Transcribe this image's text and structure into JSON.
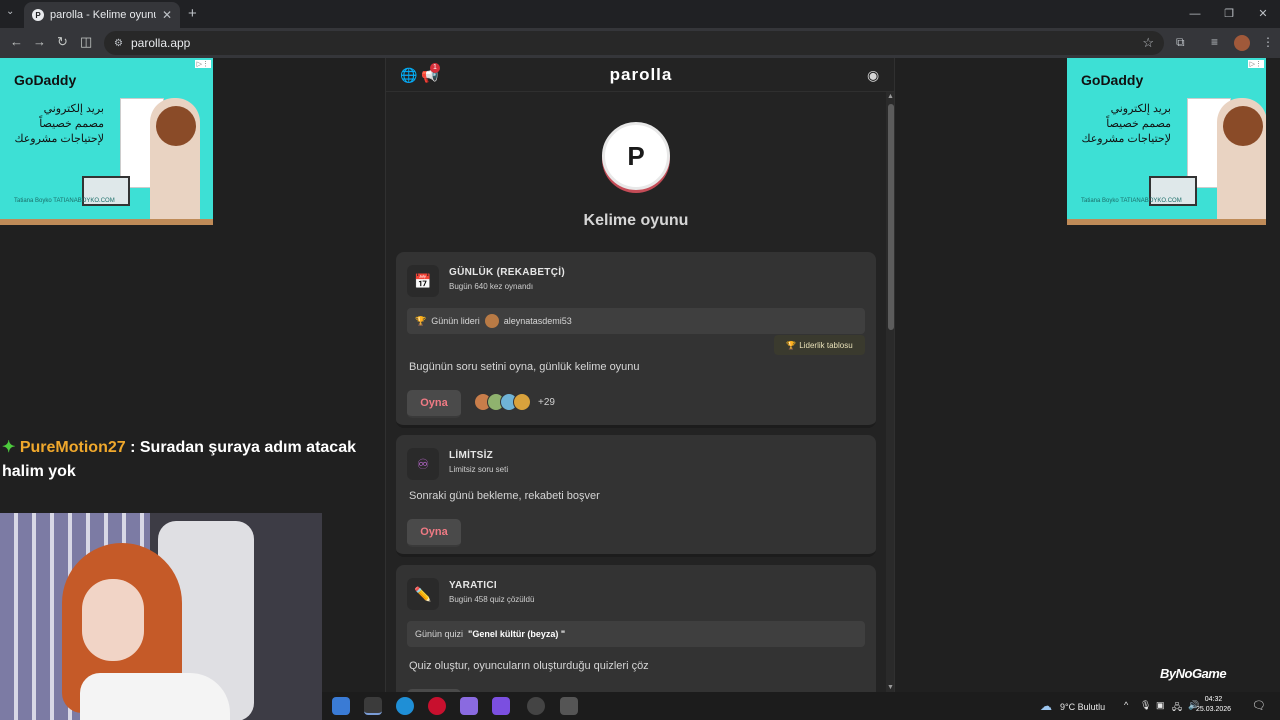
{
  "browser": {
    "tab_title": "parolla - Kelime oyunu. Günlü",
    "url": "parolla.app"
  },
  "ads": {
    "brand": "GoDaddy",
    "text": "بريد إلكتروني مصمم خصيصاً لإحتياجات مشروعك",
    "signature": "Tatiana Boyko TATIANABOYKO.COM"
  },
  "stream": {
    "chat_user": "PureMotion27",
    "chat_message": ": Suradan şuraya adım atacak halim yok",
    "watermark": "ByNoGame"
  },
  "app": {
    "brand": "parolla",
    "notification_count": "1",
    "avatar_letter": "P",
    "page_title": "Kelime oyunu",
    "cards": {
      "daily": {
        "title": "GÜNLÜK (REKABETÇİ)",
        "subtitle": "Bugün 640 kez oynandı",
        "leader_label": "Günün lideri",
        "leader_name": "aleynatasdemi53",
        "leaderboard_button": "Liderlik tablosu",
        "description": "Bugünün soru setini oyna, günlük kelime oyunu",
        "play_label": "Oyna",
        "more_players": "+29"
      },
      "unlimited": {
        "title": "LİMİTSİZ",
        "subtitle": "Limitsiz soru seti",
        "description": "Sonraki günü bekleme, rekabeti boşver",
        "play_label": "Oyna"
      },
      "creative": {
        "title": "YARATICI",
        "subtitle": "Bugün 458 quiz çözüldü",
        "quiz_label": "Günün quizi",
        "quiz_name": "\"Genel kültür (beyza) \"",
        "description": "Quiz oluştur, oyuncuların oluşturduğu quizleri çöz"
      }
    }
  },
  "taskbar": {
    "weather": "9°C  Bulutlu",
    "time": "04:32",
    "date": "25.03.2026"
  },
  "colors": {
    "ad_bg": "#3de0d5",
    "accent": "#f07a84",
    "chat_user": "#f0a82c"
  }
}
